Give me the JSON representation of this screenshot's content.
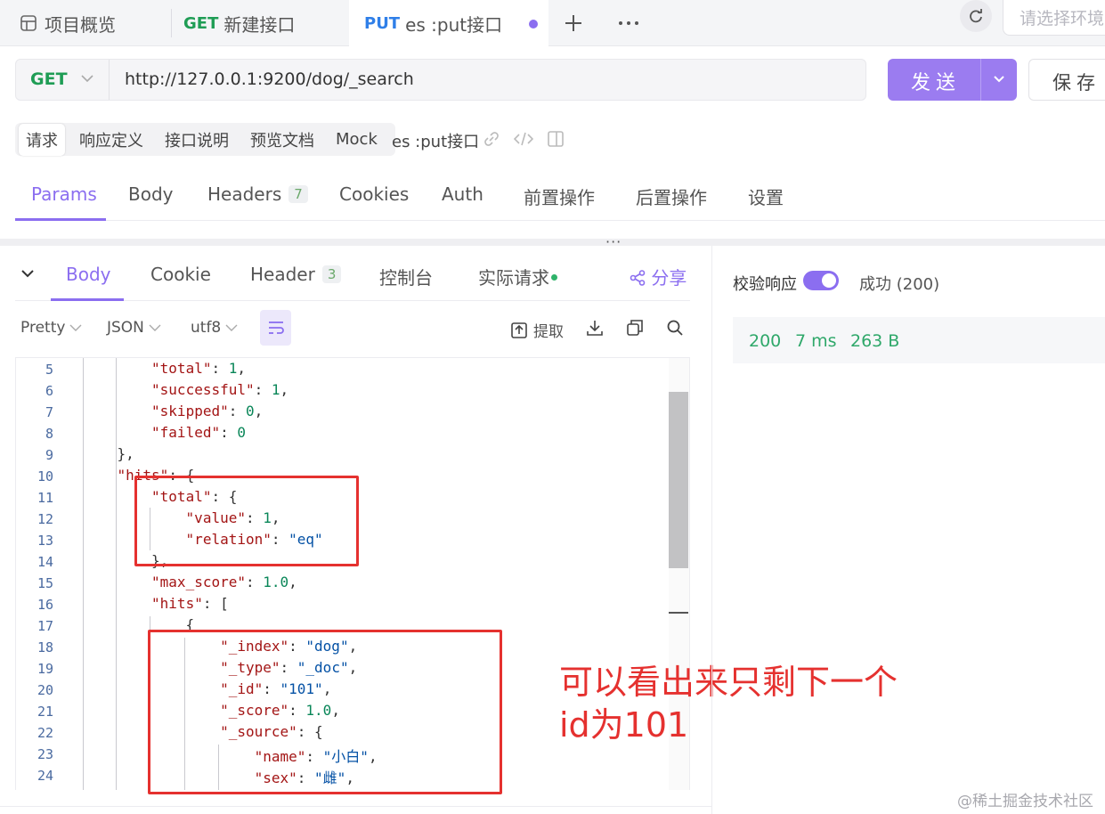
{
  "tabs": {
    "overview": "项目概览",
    "tab1_method": "GET",
    "tab1_name": "新建接口",
    "tab2_method": "PUT",
    "tab2_name": "es :put接口",
    "env_placeholder": "请选择环境"
  },
  "request": {
    "method": "GET",
    "url": "http://127.0.0.1:9200/dog/_search",
    "send_label": "发送",
    "save_label": "保存"
  },
  "doc_tabs": [
    "请求",
    "响应定义",
    "接口说明",
    "预览文档",
    "Mock"
  ],
  "doc_name": "es :put接口",
  "request_tabs": {
    "params": "Params",
    "body": "Body",
    "headers": "Headers",
    "headers_count": "7",
    "cookies": "Cookies",
    "auth": "Auth",
    "pre": "前置操作",
    "post": "后置操作",
    "settings": "设置"
  },
  "response_tabs": {
    "body": "Body",
    "cookie": "Cookie",
    "header": "Header",
    "header_count": "3",
    "console": "控制台",
    "actual": "实际请求",
    "share": "分享"
  },
  "response_toolbar": {
    "format": "Pretty",
    "type": "JSON",
    "encoding": "utf8",
    "extract": "提取"
  },
  "code_lines": [
    {
      "n": "5",
      "indent": 8,
      "parts": [
        [
          "k",
          "\"total\""
        ],
        [
          "p",
          ": "
        ],
        [
          "n",
          "1"
        ],
        [
          "p",
          ","
        ]
      ]
    },
    {
      "n": "6",
      "indent": 8,
      "parts": [
        [
          "k",
          "\"successful\""
        ],
        [
          "p",
          ": "
        ],
        [
          "n",
          "1"
        ],
        [
          "p",
          ","
        ]
      ]
    },
    {
      "n": "7",
      "indent": 8,
      "parts": [
        [
          "k",
          "\"skipped\""
        ],
        [
          "p",
          ": "
        ],
        [
          "n",
          "0"
        ],
        [
          "p",
          ","
        ]
      ]
    },
    {
      "n": "8",
      "indent": 8,
      "parts": [
        [
          "k",
          "\"failed\""
        ],
        [
          "p",
          ": "
        ],
        [
          "n",
          "0"
        ]
      ]
    },
    {
      "n": "9",
      "indent": 4,
      "parts": [
        [
          "p",
          "},"
        ]
      ]
    },
    {
      "n": "10",
      "indent": 4,
      "parts": [
        [
          "k",
          "\"hits\""
        ],
        [
          "p",
          ": {"
        ]
      ]
    },
    {
      "n": "11",
      "indent": 8,
      "parts": [
        [
          "k",
          "\"total\""
        ],
        [
          "p",
          ": {"
        ]
      ]
    },
    {
      "n": "12",
      "indent": 12,
      "parts": [
        [
          "k",
          "\"value\""
        ],
        [
          "p",
          ": "
        ],
        [
          "n",
          "1"
        ],
        [
          "p",
          ","
        ]
      ]
    },
    {
      "n": "13",
      "indent": 12,
      "parts": [
        [
          "k",
          "\"relation\""
        ],
        [
          "p",
          ": "
        ],
        [
          "s",
          "\"eq\""
        ]
      ]
    },
    {
      "n": "14",
      "indent": 8,
      "parts": [
        [
          "p",
          "},"
        ]
      ]
    },
    {
      "n": "15",
      "indent": 8,
      "parts": [
        [
          "k",
          "\"max_score\""
        ],
        [
          "p",
          ": "
        ],
        [
          "n",
          "1.0"
        ],
        [
          "p",
          ","
        ]
      ]
    },
    {
      "n": "16",
      "indent": 8,
      "parts": [
        [
          "k",
          "\"hits\""
        ],
        [
          "p",
          ": ["
        ]
      ]
    },
    {
      "n": "17",
      "indent": 12,
      "parts": [
        [
          "p",
          "{"
        ]
      ]
    },
    {
      "n": "18",
      "indent": 16,
      "parts": [
        [
          "k",
          "\"_index\""
        ],
        [
          "p",
          ": "
        ],
        [
          "s",
          "\"dog\""
        ],
        [
          "p",
          ","
        ]
      ]
    },
    {
      "n": "19",
      "indent": 16,
      "parts": [
        [
          "k",
          "\"_type\""
        ],
        [
          "p",
          ": "
        ],
        [
          "s",
          "\"_doc\""
        ],
        [
          "p",
          ","
        ]
      ]
    },
    {
      "n": "20",
      "indent": 16,
      "parts": [
        [
          "k",
          "\"_id\""
        ],
        [
          "p",
          ": "
        ],
        [
          "s",
          "\"101\""
        ],
        [
          "p",
          ","
        ]
      ]
    },
    {
      "n": "21",
      "indent": 16,
      "parts": [
        [
          "k",
          "\"_score\""
        ],
        [
          "p",
          ": "
        ],
        [
          "n",
          "1.0"
        ],
        [
          "p",
          ","
        ]
      ]
    },
    {
      "n": "22",
      "indent": 16,
      "parts": [
        [
          "k",
          "\"_source\""
        ],
        [
          "p",
          ": {"
        ]
      ]
    },
    {
      "n": "23",
      "indent": 20,
      "parts": [
        [
          "k",
          "\"name\""
        ],
        [
          "p",
          ": "
        ],
        [
          "s",
          "\"小白\""
        ],
        [
          "p",
          ","
        ]
      ]
    },
    {
      "n": "24",
      "indent": 20,
      "parts": [
        [
          "k",
          "\"sex\""
        ],
        [
          "p",
          ": "
        ],
        [
          "s",
          "\"雌\""
        ],
        [
          "p",
          ","
        ]
      ]
    }
  ],
  "annotation": {
    "line1": "可以看出来只剩下一个",
    "line2": "id为101"
  },
  "validation": {
    "label": "校验响应",
    "enabled": true,
    "status": "成功 (200)"
  },
  "stats": {
    "code": "200",
    "time": "7 ms",
    "size": "263 B"
  },
  "colors": {
    "accent": "#8b6ef0",
    "get": "#1f9d55",
    "put": "#2f7fe8",
    "annotation": "#e5312f"
  },
  "watermark": "@稀土掘金技术社区"
}
